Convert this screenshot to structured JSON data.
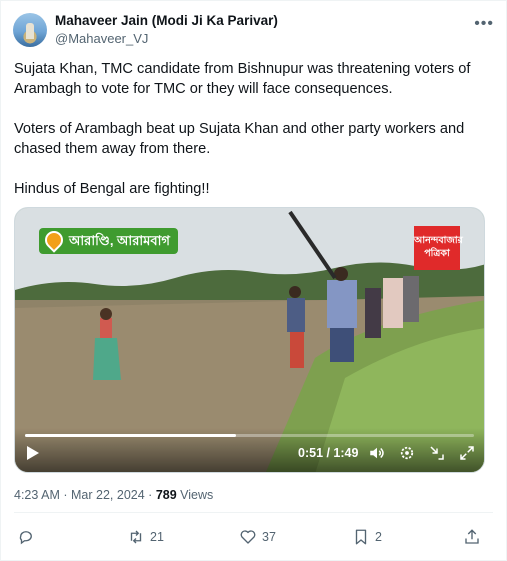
{
  "author": {
    "display_name": "Mahaveer Jain (Modi Ji Ka Parivar)",
    "handle": "@Mahaveer_VJ",
    "more_icon": "more-horizontal-icon"
  },
  "post": {
    "paragraphs": [
      "Sujata Khan, TMC candidate from Bishnupur was threatening voters of Arambagh to vote for TMC or they will face consequences.",
      "Voters of Arambagh beat up Sujata Khan and other party workers and chased them away from there.",
      "Hindus of Bengal are fighting!!"
    ]
  },
  "video": {
    "location_tag": "আরাণ্ডি, আরামবাগ",
    "news_logo": "আনন্দবাজার পত্রিকা",
    "time": "0:51 / 1:49",
    "progress": 0.47,
    "icons": [
      "play-icon",
      "volume-icon",
      "settings-icon",
      "pip-icon",
      "fullscreen-icon"
    ]
  },
  "meta": {
    "time": "4:23 AM",
    "date": "Mar 22, 2024",
    "views_count": "789",
    "views_label": "Views"
  },
  "actions": {
    "reply": {
      "icon": "reply-icon",
      "count": ""
    },
    "repost": {
      "icon": "repost-icon",
      "count": "21"
    },
    "like": {
      "icon": "heart-icon",
      "count": "37"
    },
    "bookmark": {
      "icon": "bookmark-icon",
      "count": "2"
    },
    "share": {
      "icon": "share-icon",
      "count": ""
    }
  },
  "colors": {
    "text": "#0f1419",
    "secondary": "#536471",
    "border": "#eff3f4",
    "news_red": "#e02a2a",
    "tag_green": "#3f9b2f"
  }
}
